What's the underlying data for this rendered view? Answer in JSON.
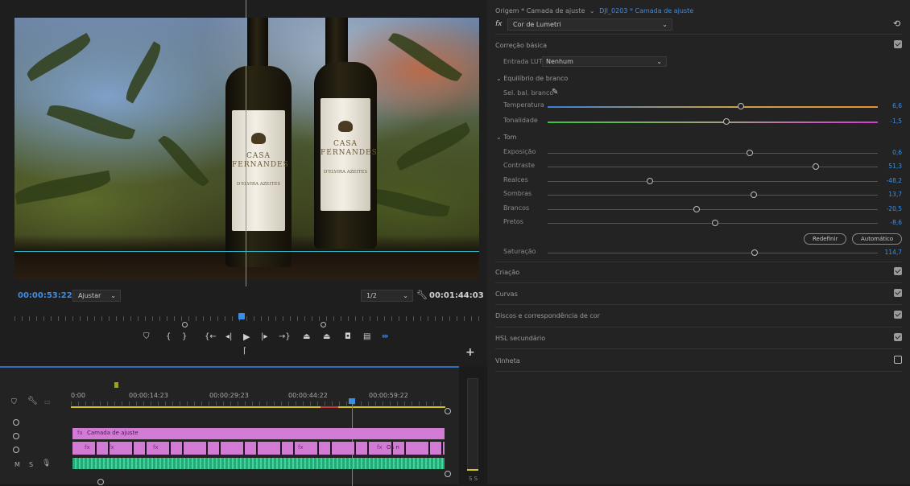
{
  "monitor": {
    "timecode_current": "00:00:53:22",
    "fit_label": "Ajustar",
    "resolution": "1/2",
    "timecode_duration": "00:01:44:03",
    "transport_icons": [
      "marker-icon",
      "in-point-icon",
      "out-point-icon",
      "go-to-in-icon",
      "step-back-icon",
      "play-icon",
      "step-forward-icon",
      "go-to-out-icon",
      "lift-icon",
      "extract-icon",
      "camera-icon",
      "button-editor-icon",
      "comparison-icon"
    ],
    "add_label": "+"
  },
  "video": {
    "bottle_left": {
      "brand": "CASA FERNANDES",
      "sub": "D'ELVIRA AZEITES"
    },
    "bottle_right": {
      "brand": "CASA FERNANDES",
      "sub": "D'ELVIRA AZEITES"
    }
  },
  "timeline": {
    "ruler": [
      "0:00",
      "00:00:14:23",
      "00:00:29:23",
      "00:00:44:22",
      "00:00:59:22"
    ],
    "adjustment_clip": "Camada de ajuste",
    "clip_fx": "fx",
    "clip_name": "Os n",
    "audio_track_labels": [
      "M",
      "S"
    ],
    "meter_label": "S S"
  },
  "lumetri": {
    "header_source": "Origem * Camada de ajuste",
    "header_clip": "DJI_0203 * Camada de ajuste",
    "fx_label": "fx",
    "effect_name": "Cor de Lumetri",
    "basic_title": "Correção básica",
    "lut_label": "Entrada LUT",
    "lut_value": "Nenhum",
    "wb_title": "Equilíbrio de branco",
    "wb_selector": "Sel. bal. branco",
    "tone_title": "Tom",
    "sliders": [
      {
        "label": "Temperatura",
        "value": "6,6"
      },
      {
        "label": "Tonalidade",
        "value": "-1,5"
      },
      {
        "label": "Exposição",
        "value": "0,6"
      },
      {
        "label": "Contraste",
        "value": "51,3"
      },
      {
        "label": "Realces",
        "value": "-48,2"
      },
      {
        "label": "Sombras",
        "value": "13,7"
      },
      {
        "label": "Brancos",
        "value": "-20,5"
      },
      {
        "label": "Pretos",
        "value": "-8,6"
      },
      {
        "label": "Saturação",
        "value": "114,7"
      }
    ],
    "reset_label": "Redefinir",
    "auto_label": "Automático",
    "sections": [
      "Criação",
      "Curvas",
      "Discos e correspondência de cor",
      "HSL secundário",
      "Vinheta"
    ]
  }
}
